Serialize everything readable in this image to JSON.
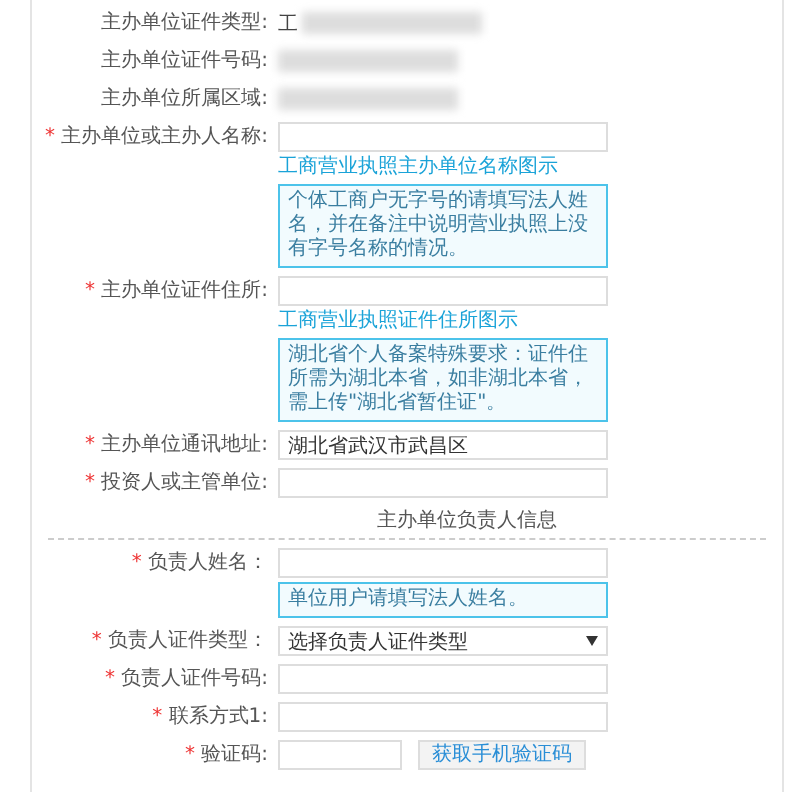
{
  "info_rows": [
    {
      "label": "主办单位证件类型:",
      "value": "工",
      "redacted": true
    },
    {
      "label": "主办单位证件号码:",
      "redacted": true
    },
    {
      "label": "主办单位所属区域:",
      "redacted": true
    }
  ],
  "fields": [
    {
      "kind": "input",
      "required_mark": "*",
      "label": "主办单位或主办人名称:",
      "link": "工商营业执照主办单位名称图示",
      "tip": "个体工商户无字号的请填写法人姓名，并在备注中说明营业执照上没有字号名称的情况。"
    },
    {
      "kind": "input",
      "required_mark": "*",
      "label": "主办单位证件住所:",
      "link": "工商营业执照证件住所图示",
      "tip": "湖北省个人备案特殊要求：证件住所需为湖北本省，如非湖北本省，需上传\"湖北省暂住证\"。"
    },
    {
      "kind": "input",
      "required_mark": "*",
      "label": "主办单位通讯地址:",
      "value": "湖北省武汉市武昌区"
    },
    {
      "kind": "input",
      "required_mark": "*",
      "label": "投资人或主管单位:"
    }
  ],
  "section_title": "主办单位负责人信息",
  "person_fields": [
    {
      "kind": "input",
      "required_mark": "*",
      "label": "负责人姓名：",
      "tip": "单位用户请填写法人姓名。"
    },
    {
      "kind": "select",
      "required_mark": "*",
      "label": "负责人证件类型：",
      "value": "选择负责人证件类型"
    },
    {
      "kind": "input",
      "required_mark": "*",
      "label": "负责人证件号码:"
    },
    {
      "kind": "input",
      "required_mark": "*",
      "label": "联系方式1:"
    },
    {
      "kind": "code",
      "required_mark": "*",
      "label": "验证码:",
      "button": "获取手机验证码"
    }
  ]
}
